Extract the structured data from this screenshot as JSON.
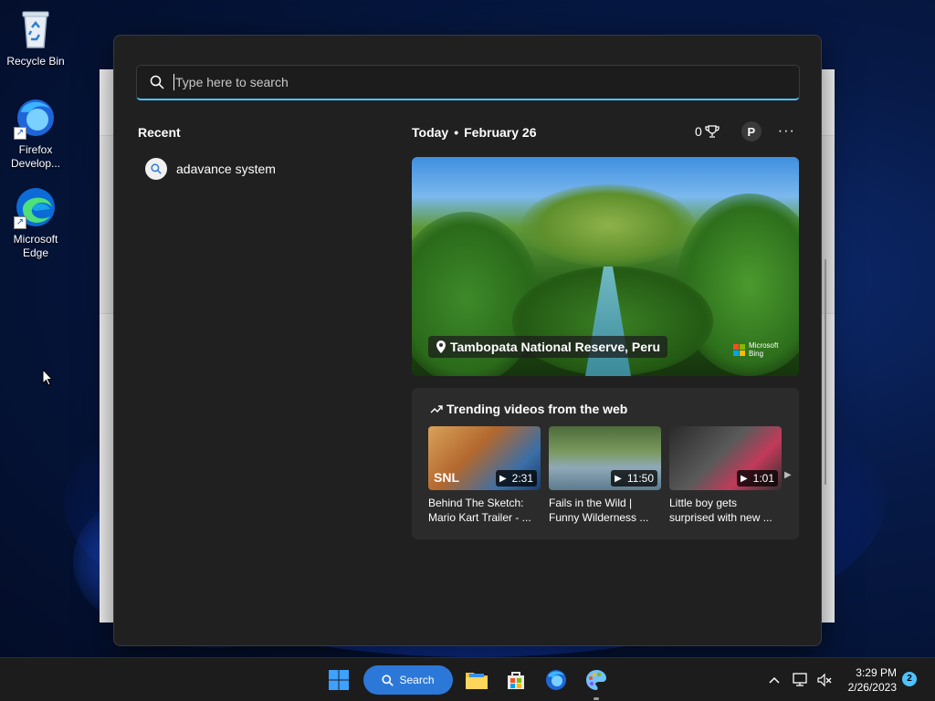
{
  "desktop": {
    "icons": [
      {
        "label_line1": "Recycle Bin",
        "label_line2": ""
      },
      {
        "label_line1": "Firefox",
        "label_line2": "Develop..."
      },
      {
        "label_line1": "Microsoft",
        "label_line2": "Edge"
      }
    ]
  },
  "search": {
    "placeholder": "Type here to search",
    "value": ""
  },
  "recent": {
    "title": "Recent",
    "items": [
      {
        "label": "adavance system"
      }
    ]
  },
  "highlights": {
    "today_label": "Today",
    "separator": "•",
    "date": "February 26",
    "points": "0",
    "avatar_initial": "P",
    "more": "···"
  },
  "hero": {
    "location": "Tambopata National Reserve, Peru",
    "brand_line1": "Microsoft",
    "brand_line2": "Bing"
  },
  "trending": {
    "title": "Trending videos from the web",
    "videos": [
      {
        "duration": "2:31",
        "title_line1": "Behind The Sketch:",
        "title_line2": "Mario Kart Trailer - ..."
      },
      {
        "duration": "11:50",
        "title_line1": "Fails in the Wild |",
        "title_line2": "Funny Wilderness ..."
      },
      {
        "duration": "1:01",
        "title_line1": "Little boy gets",
        "title_line2": "surprised with new ..."
      }
    ]
  },
  "taskbar": {
    "search_label": "Search",
    "time": "3:29 PM",
    "date": "2/26/2023",
    "notification_count": "2"
  },
  "colors": {
    "accent": "#4cc2ff",
    "panel_bg": "#202020",
    "card_bg": "#2b2b2b",
    "search_pill": "#2c78d8"
  }
}
